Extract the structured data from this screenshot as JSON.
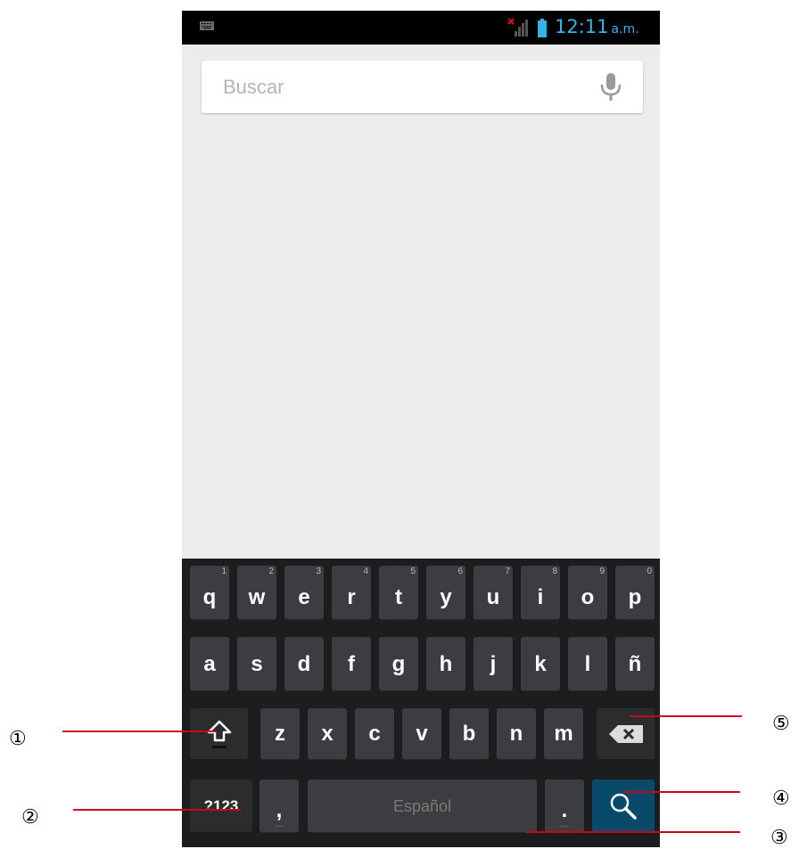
{
  "status_bar": {
    "notification_icon": "keyboard-icon",
    "signal_icon": "signal-no-service-icon",
    "battery_icon": "battery-icon",
    "time": "12:11",
    "ampm": "a.m."
  },
  "search": {
    "placeholder": "Buscar",
    "value": "",
    "mic_icon": "microphone-icon"
  },
  "keyboard": {
    "row1": [
      {
        "label": "q",
        "hint": "1"
      },
      {
        "label": "w",
        "hint": "2"
      },
      {
        "label": "e",
        "hint": "3"
      },
      {
        "label": "r",
        "hint": "4"
      },
      {
        "label": "t",
        "hint": "5"
      },
      {
        "label": "y",
        "hint": "6"
      },
      {
        "label": "u",
        "hint": "7"
      },
      {
        "label": "i",
        "hint": "8"
      },
      {
        "label": "o",
        "hint": "9"
      },
      {
        "label": "p",
        "hint": "0"
      }
    ],
    "row2": [
      {
        "label": "a"
      },
      {
        "label": "s"
      },
      {
        "label": "d"
      },
      {
        "label": "f"
      },
      {
        "label": "g"
      },
      {
        "label": "h"
      },
      {
        "label": "j"
      },
      {
        "label": "k"
      },
      {
        "label": "l"
      },
      {
        "label": "ñ"
      }
    ],
    "row3": [
      {
        "label": "z"
      },
      {
        "label": "x"
      },
      {
        "label": "c"
      },
      {
        "label": "v"
      },
      {
        "label": "b"
      },
      {
        "label": "n"
      },
      {
        "label": "m"
      }
    ],
    "shift_icon": "shift-icon",
    "backspace_icon": "backspace-icon",
    "symbols_label": "?123",
    "comma_label": ",",
    "space_label": "Español",
    "period_label": ".",
    "search_icon": "search-icon"
  },
  "callouts": [
    "①",
    "②",
    "③",
    "④",
    "⑤"
  ],
  "colors": {
    "accent": "#33b5e5",
    "keyboard_bg": "#1c1d1f",
    "key_bg": "#3b3d40",
    "search_key_bg": "#094a6b",
    "pointer_line": "#d0021b"
  }
}
